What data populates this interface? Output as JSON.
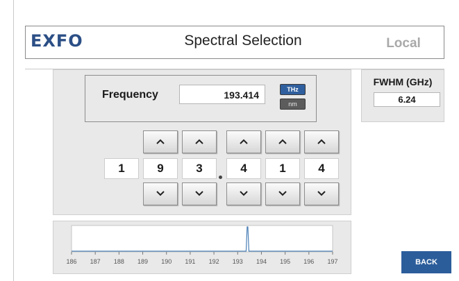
{
  "header": {
    "logo": "EXFO",
    "title": "Spectral Selection",
    "mode": "Local"
  },
  "frequency": {
    "label": "Frequency",
    "value": "193.414",
    "units": [
      "THz",
      "nm"
    ],
    "selected_unit": "THz",
    "digits": [
      "1",
      "9",
      "3",
      "4",
      "1",
      "4"
    ]
  },
  "fwhm": {
    "label": "FWHM (GHz)",
    "value": "6.24"
  },
  "spectrum": {
    "ticks": [
      "186",
      "187",
      "188",
      "189",
      "190",
      "191",
      "192",
      "193",
      "194",
      "195",
      "196",
      "197"
    ],
    "peak_thz": 193.414,
    "range_thz": [
      186,
      197
    ]
  },
  "actions": {
    "back": "BACK"
  },
  "colors": {
    "accent": "#2b5d9b",
    "logo": "#2c4f86",
    "panel": "#e9e9e9",
    "trace": "#4a7fb5"
  }
}
